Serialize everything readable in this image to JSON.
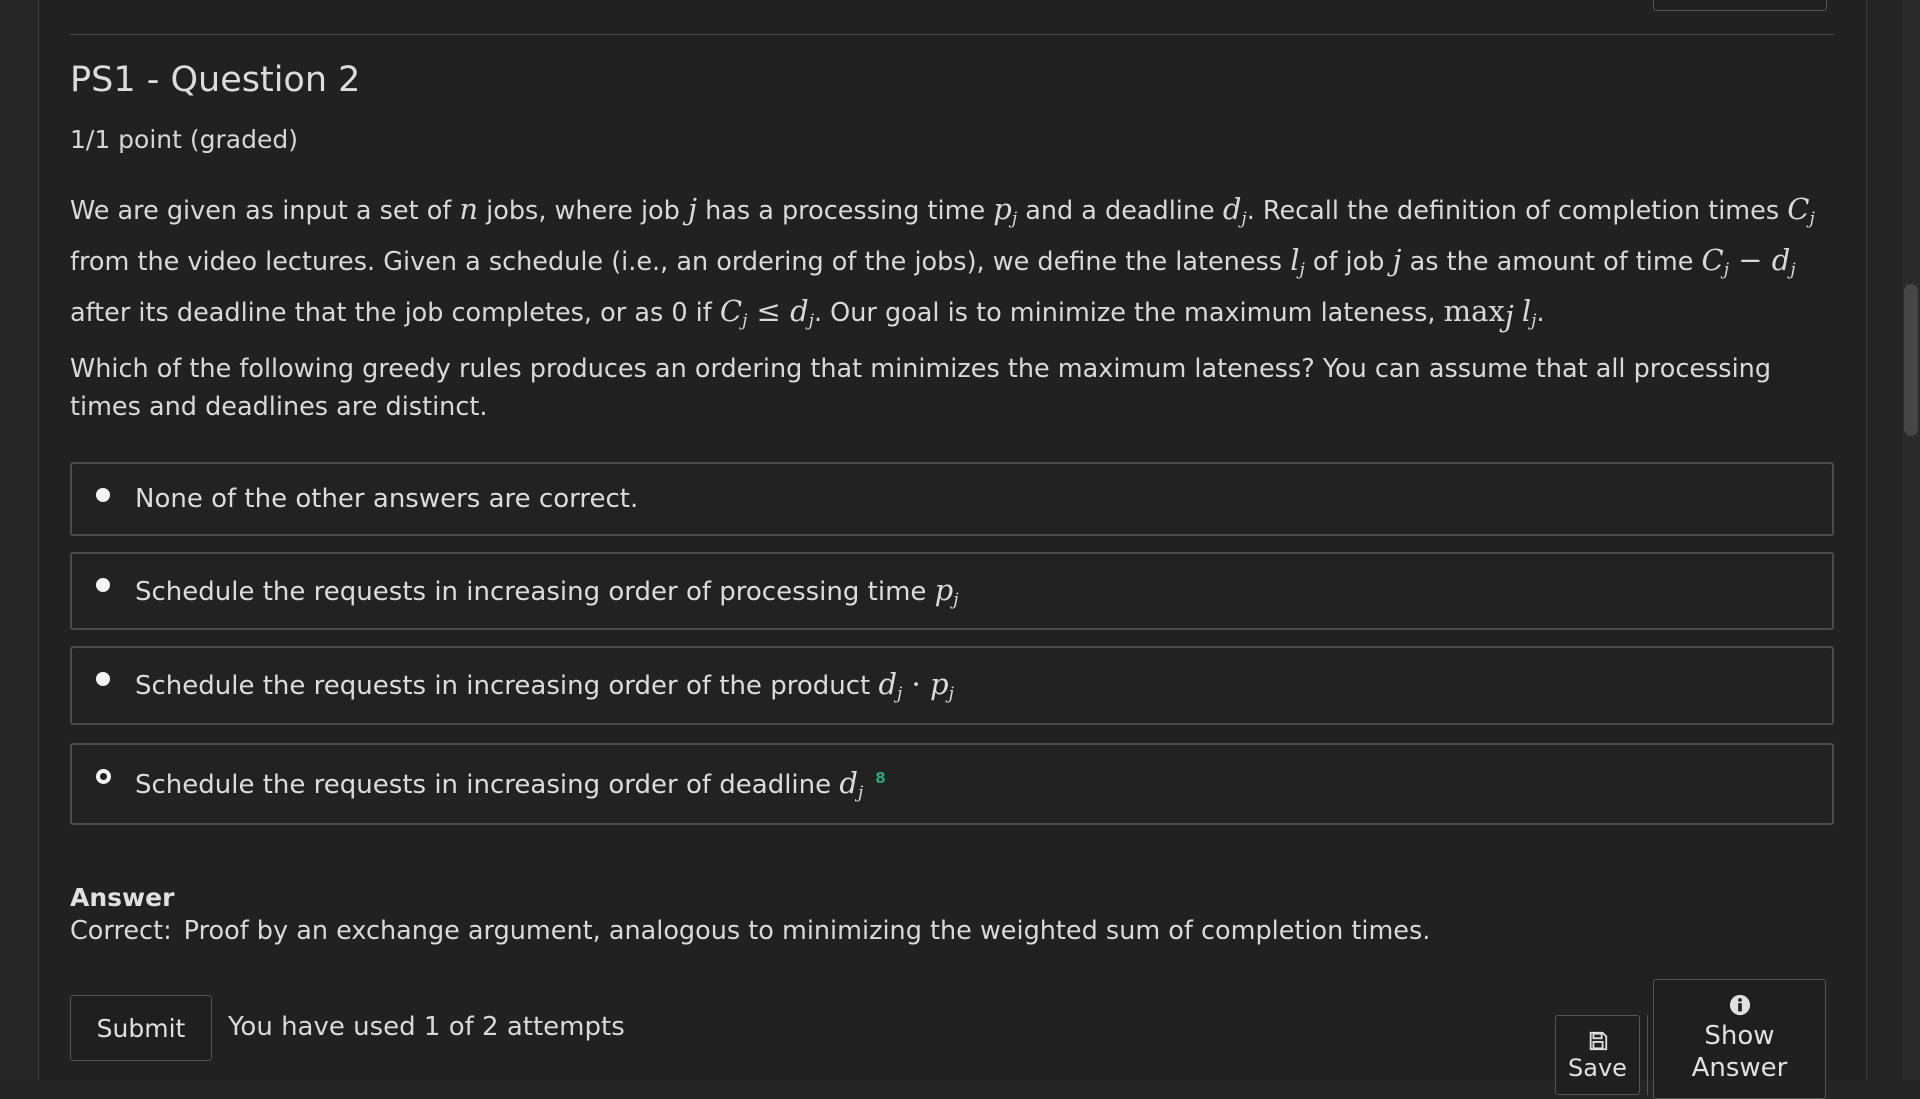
{
  "problem": {
    "title": "PS1 - Question 2",
    "grade": "1/1 point (graded)",
    "p1": {
      "t1": "We are given as input a set of ",
      "n": "n",
      "t2": " jobs, where job ",
      "j1": "j",
      "t3": " has a processing time ",
      "p": "p",
      "t4": " and a deadline ",
      "d": "d",
      "t5": ". Recall the definition of completion times ",
      "C": "C",
      "t6": " from the video lectures. Given a schedule (i.e., an ordering of the jobs), we define the lateness ",
      "l": "l",
      "t7": " of job ",
      "j2": "j",
      "t8": " as the amount of time ",
      "t9": " after its deadline that the job completes, or as 0 if ",
      "t10": ". Our goal is to minimize the maximum lateness, ",
      "max": "max",
      "t11": "."
    },
    "sub_j": "j",
    "minus": " − ",
    "leq": " ≤ ",
    "dot": " · ",
    "p2": "Which of the following greedy rules produces an ordering that minimizes the maximum lateness? You can assume that all processing times and deadlines are distinct."
  },
  "options": [
    {
      "text": "None of the other answers are correct.",
      "selected": false
    },
    {
      "text": "Schedule the requests in increasing order of processing time ",
      "selected": false
    },
    {
      "text": "Schedule the requests in increasing order of the product ",
      "selected": false
    },
    {
      "text": "Schedule the requests in increasing order of deadline ",
      "selected": true
    }
  ],
  "correct_mark": "8",
  "answer": {
    "heading": "Answer",
    "label": "Correct:",
    "text": "Proof by an exchange argument, analogous to minimizing the weighted sum of completion times."
  },
  "actions": {
    "submit": "Submit",
    "attempts": "You have used 1 of 2 attempts",
    "save": "Save",
    "show_answer": "Show Answer"
  },
  "colors": {
    "background": "#212121",
    "correct": "#2aa876"
  }
}
